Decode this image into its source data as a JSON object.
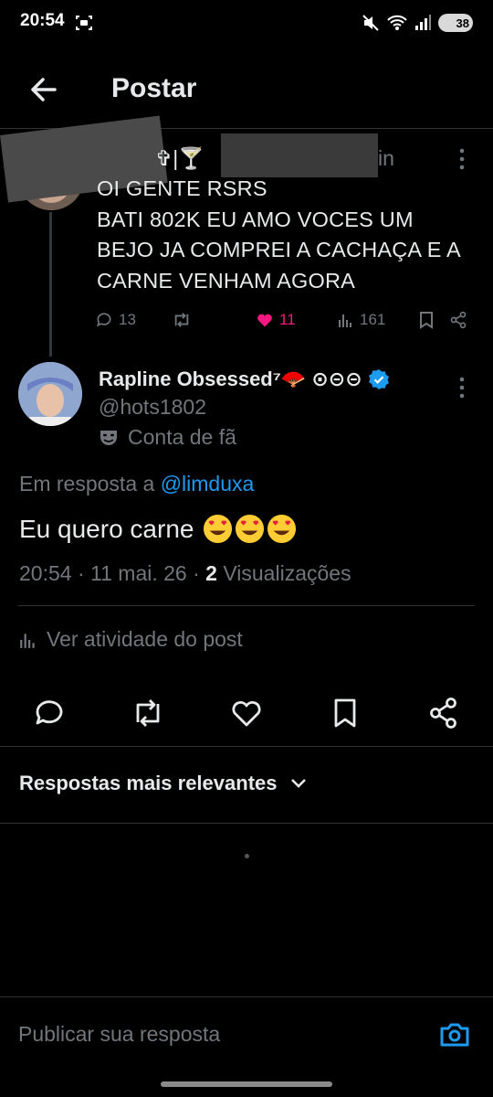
{
  "status_bar": {
    "time": "20:54",
    "battery": "38"
  },
  "header": {
    "title": "Postar"
  },
  "parent_tweet": {
    "name_tail": "✞|🍸",
    "handle_tail": "in",
    "lines": [
      "OI GENTE RSRS",
      "BATI 802K EU AMO VOCES UM",
      "BEJO JA COMPREI A CACHAÇA E A",
      "CARNE VENHAM AGORA"
    ],
    "replies": "13",
    "likes": "11",
    "views": "161"
  },
  "tweet": {
    "name": "Rapline Obsessed⁷🪭 ⊙⊝⊝",
    "handle": "@hots1802",
    "badge": "Conta de fã",
    "reply_prefix": "Em resposta a",
    "reply_mention": "@limduxa",
    "text": "Eu quero carne",
    "time": "20:54",
    "date": "11 mai. 26",
    "views_count": "2",
    "views_label": "Visualizações",
    "activity": "Ver atividade do post"
  },
  "replies_sort": {
    "label": "Respostas mais relevantes"
  },
  "reply_box": {
    "placeholder": "Publicar sua resposta"
  },
  "colors": {
    "accent": "#1d9bf0",
    "like": "#f91880",
    "muted": "#71767b",
    "background": "#000000"
  }
}
